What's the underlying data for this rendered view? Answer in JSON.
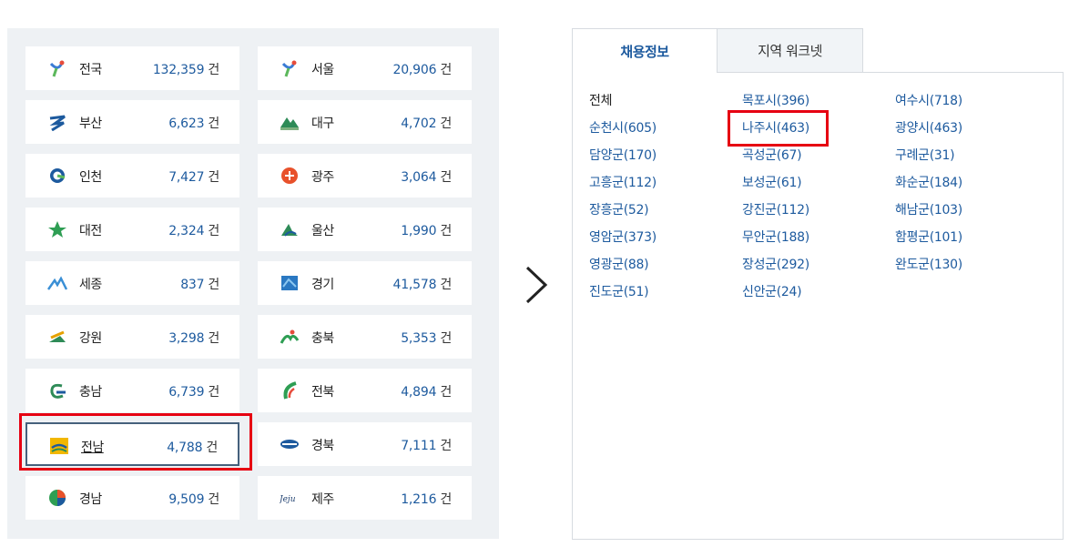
{
  "regions": [
    {
      "name": "전국",
      "count": "132,359",
      "unit": "건",
      "icon": "nation-logo-icon"
    },
    {
      "name": "서울",
      "count": "20,906",
      "unit": "건",
      "icon": "seoul-logo-icon"
    },
    {
      "name": "부산",
      "count": "6,623",
      "unit": "건",
      "icon": "busan-logo-icon"
    },
    {
      "name": "대구",
      "count": "4,702",
      "unit": "건",
      "icon": "daegu-logo-icon"
    },
    {
      "name": "인천",
      "count": "7,427",
      "unit": "건",
      "icon": "incheon-logo-icon"
    },
    {
      "name": "광주",
      "count": "3,064",
      "unit": "건",
      "icon": "gwangju-logo-icon"
    },
    {
      "name": "대전",
      "count": "2,324",
      "unit": "건",
      "icon": "daejeon-logo-icon"
    },
    {
      "name": "울산",
      "count": "1,990",
      "unit": "건",
      "icon": "ulsan-logo-icon"
    },
    {
      "name": "세종",
      "count": "837",
      "unit": "건",
      "icon": "sejong-logo-icon"
    },
    {
      "name": "경기",
      "count": "41,578",
      "unit": "건",
      "icon": "gyeonggi-logo-icon"
    },
    {
      "name": "강원",
      "count": "3,298",
      "unit": "건",
      "icon": "gangwon-logo-icon"
    },
    {
      "name": "충북",
      "count": "5,353",
      "unit": "건",
      "icon": "chungbuk-logo-icon"
    },
    {
      "name": "충남",
      "count": "6,739",
      "unit": "건",
      "icon": "chungnam-logo-icon"
    },
    {
      "name": "전북",
      "count": "4,894",
      "unit": "건",
      "icon": "jeonbuk-logo-icon"
    },
    {
      "name": "전남",
      "count": "4,788",
      "unit": "건",
      "icon": "jeonnam-logo-icon",
      "selected": true
    },
    {
      "name": "경북",
      "count": "7,111",
      "unit": "건",
      "icon": "gyeongbuk-logo-icon"
    },
    {
      "name": "경남",
      "count": "9,509",
      "unit": "건",
      "icon": "gyeongnam-logo-icon"
    },
    {
      "name": "제주",
      "count": "1,216",
      "unit": "건",
      "icon": "jeju-logo-icon",
      "logo_text": "Jeju"
    }
  ],
  "tabs": {
    "active": "채용정보",
    "inactive": "지역 워크넷"
  },
  "cities": [
    "전체",
    "목포시(396)",
    "여수시(718)",
    "순천시(605)",
    "나주시(463)",
    "광양시(463)",
    "담양군(170)",
    "곡성군(67)",
    "구례군(31)",
    "고흥군(112)",
    "보성군(61)",
    "화순군(184)",
    "장흥군(52)",
    "강진군(112)",
    "해남군(103)",
    "영암군(373)",
    "무안군(188)",
    "함평군(101)",
    "영광군(88)",
    "장성군(292)",
    "완도군(130)",
    "진도군(51)",
    "신안군(24)"
  ],
  "colors": {
    "accent": "#1d5a9e",
    "highlight_box": "#e60012",
    "panel_bg": "#eef1f4"
  },
  "icons": {
    "arrow": "chevron-right-icon"
  }
}
